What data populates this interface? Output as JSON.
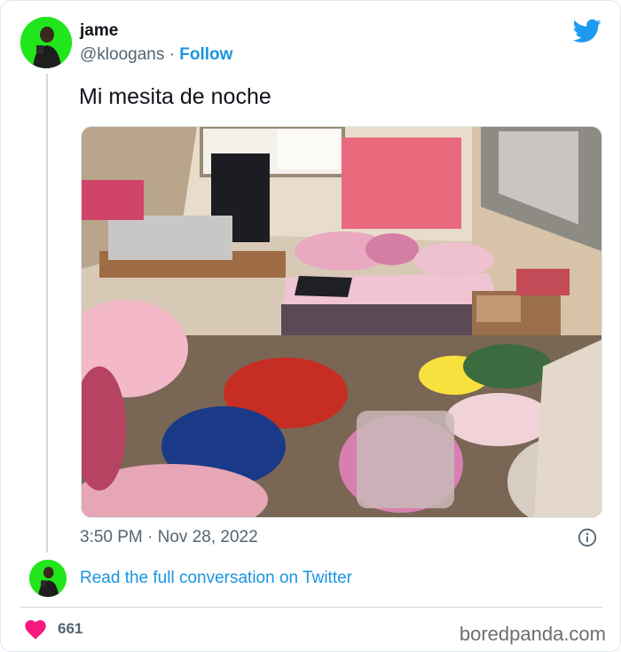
{
  "tweet": {
    "author_name": "jame",
    "handle": "@kloogans",
    "separator": " · ",
    "follow_label": "Follow",
    "text": "Mi mesita de noche",
    "timestamp": "3:50 PM · Nov 28, 2022",
    "read_more_label": "Read the full conversation on Twitter",
    "like_count": "661"
  },
  "footer": {
    "watermark": "boredpanda.com"
  },
  "colors": {
    "twitter_blue": "#1d9bf0",
    "link_blue": "#1b95e0",
    "heart_pink": "#f91880",
    "avatar_green": "#22e61c",
    "secondary_text": "#536471"
  },
  "icons": {
    "brand": "twitter-bird-icon",
    "info": "info-icon",
    "like": "heart-icon"
  }
}
